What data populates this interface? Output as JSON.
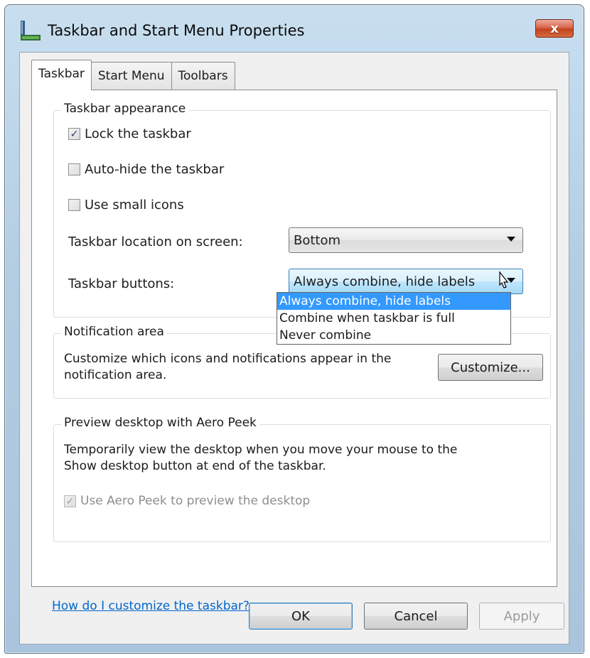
{
  "window": {
    "title": "Taskbar and Start Menu Properties",
    "close_label": "x"
  },
  "tabs": [
    {
      "label": "Taskbar",
      "active": true
    },
    {
      "label": "Start Menu",
      "active": false
    },
    {
      "label": "Toolbars",
      "active": false
    }
  ],
  "appearance": {
    "title": "Taskbar appearance",
    "lock": {
      "label": "Lock the taskbar",
      "checked": true
    },
    "autohide": {
      "label": "Auto-hide the taskbar",
      "checked": false
    },
    "small_icons": {
      "label": "Use small icons",
      "checked": false
    },
    "location_label": "Taskbar location on screen:",
    "location_value": "Bottom",
    "buttons_label": "Taskbar buttons:",
    "buttons_value": "Always combine, hide labels",
    "buttons_options": [
      "Always combine, hide labels",
      "Combine when taskbar is full",
      "Never combine"
    ]
  },
  "notification": {
    "title": "Notification area",
    "desc_line1": "Customize which icons and notifications appear in the",
    "desc_line2": "notification area.",
    "customize_label": "Customize..."
  },
  "peek": {
    "title": "Preview desktop with Aero Peek",
    "desc_line1": "Temporarily view the desktop when you move your mouse to the",
    "desc_line2": "Show desktop button at end of the taskbar.",
    "checkbox": {
      "label": "Use Aero Peek to preview the desktop",
      "checked": true,
      "disabled": true
    }
  },
  "help_link": "How do I customize the taskbar?",
  "buttons": {
    "ok": "OK",
    "cancel": "Cancel",
    "apply": "Apply"
  },
  "colors": {
    "selection": "#3399ff",
    "link": "#0066cc",
    "close_button": "#c2431f"
  }
}
